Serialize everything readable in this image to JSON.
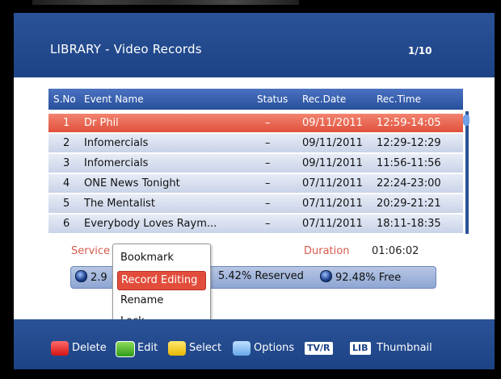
{
  "header": {
    "title": "LIBRARY - Video Records",
    "page": "1/10"
  },
  "table": {
    "columns": [
      "S.No",
      "Event Name",
      "Status",
      "Rec.Date",
      "Rec.Time"
    ],
    "rows": [
      {
        "no": "1",
        "name": "Dr Phil",
        "status": "–",
        "date": "09/11/2011",
        "time": "12:59-14:05"
      },
      {
        "no": "2",
        "name": "Infomercials",
        "status": "–",
        "date": "09/11/2011",
        "time": "12:29-12:29"
      },
      {
        "no": "3",
        "name": "Infomercials",
        "status": "–",
        "date": "09/11/2011",
        "time": "11:56-11:56"
      },
      {
        "no": "4",
        "name": "ONE News Tonight",
        "status": "–",
        "date": "07/11/2011",
        "time": "22:24-23:00"
      },
      {
        "no": "5",
        "name": "The Mentalist",
        "status": "–",
        "date": "07/11/2011",
        "time": "20:29-21:21"
      },
      {
        "no": "6",
        "name": "Everybody Loves Raym...",
        "status": "–",
        "date": "07/11/2011",
        "time": "18:11-18:35"
      }
    ],
    "selected_index": 0
  },
  "info": {
    "service_label": "Service",
    "duration_label": "Duration",
    "duration_value": "01:06:02"
  },
  "disk": {
    "used": "2.9",
    "reserved": "5.42% Reserved",
    "free": "92.48% Free"
  },
  "menu": {
    "items": [
      "Bookmark",
      "Record Editing",
      "Rename",
      "Lock"
    ],
    "selected": "Record Editing"
  },
  "footer": {
    "delete": "Delete",
    "edit": "Edit",
    "select": "Select",
    "options": "Options",
    "tvr_tag": "TV/R",
    "lib_tag": "LIB",
    "thumbnail": "Thumbnail"
  },
  "colors": {
    "accent_blue": "#2a5296",
    "selection_red": "#e24d3b",
    "label_red": "#d65a4c"
  }
}
